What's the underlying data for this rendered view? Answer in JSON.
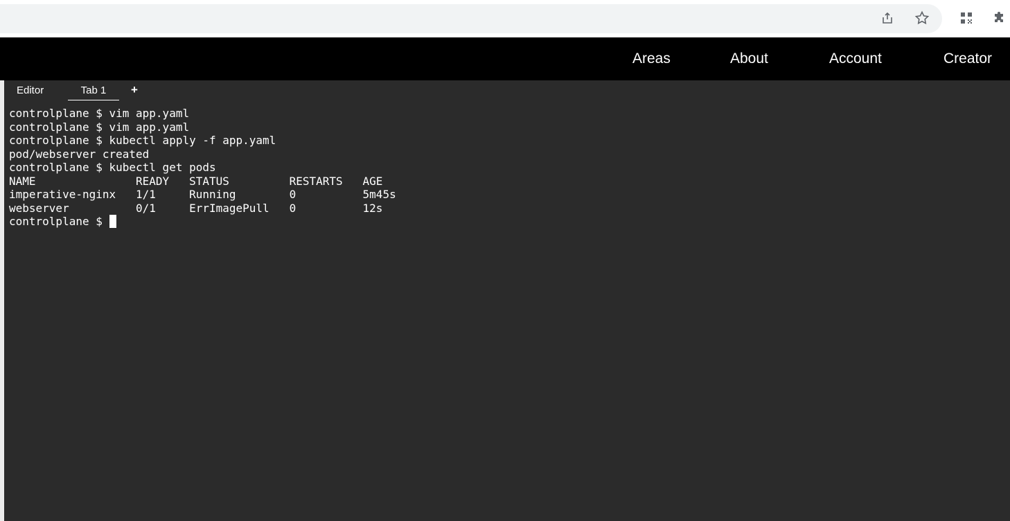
{
  "browser": {
    "icons": {
      "share": "share-icon",
      "bookmark": "bookmark-star-icon",
      "qr": "qr-code-icon",
      "extensions": "puzzle-piece-icon"
    }
  },
  "nav": {
    "items": [
      "Areas",
      "About",
      "Account",
      "Creator"
    ]
  },
  "terminal": {
    "tabs": [
      "Editor",
      "Tab 1"
    ],
    "add_tab": "+",
    "lines": [
      "controlplane $ vim app.yaml",
      "controlplane $ vim app.yaml",
      "controlplane $ kubectl apply -f app.yaml",
      "pod/webserver created",
      "controlplane $ kubectl get pods",
      "NAME               READY   STATUS         RESTARTS   AGE",
      "imperative-nginx   1/1     Running        0          5m45s",
      "webserver          0/1     ErrImagePull   0          12s"
    ],
    "prompt": "controlplane $ "
  },
  "colors": {
    "terminal_bg": "#2b2b2b",
    "nav_bg": "#000000",
    "text": "#ffffff"
  }
}
